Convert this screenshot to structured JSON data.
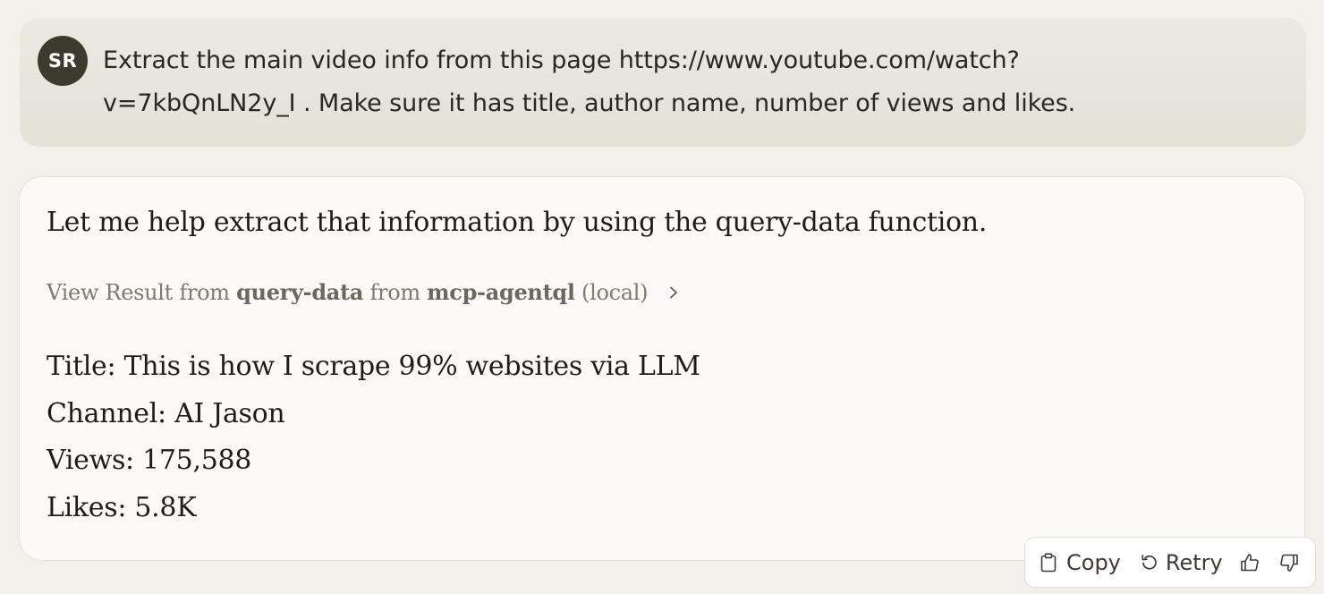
{
  "user_message": {
    "avatar_initials": "SR",
    "text_lines": [
      "Extract the main video info from this page https://www.youtube.com/watch?",
      "v=7kbQnLN2y_I . Make sure it has title, author name, number of views and likes."
    ]
  },
  "assistant_message": {
    "intro": "Let me help extract that information by using the query-data function.",
    "tool_result": {
      "prefix": "View Result from",
      "tool_name": "query-data",
      "middle": "from",
      "server_name": "mcp-agentql",
      "suffix": "(local)",
      "icon": "chevron-right-icon"
    },
    "info_lines": [
      "Title: This is how I scrape 99% websites via LLM",
      "Channel: AI Jason",
      "Views: 175,588",
      "Likes: 5.8K"
    ]
  },
  "actions": {
    "copy_label": "Copy",
    "retry_label": "Retry",
    "copy_icon": "clipboard-icon",
    "retry_icon": "retry-icon",
    "thumbs_up_icon": "thumbs-up-icon",
    "thumbs_down_icon": "thumbs-down-icon"
  },
  "colors": {
    "page_background": "#f2f0ea",
    "user_bubble": "#e7e5dc",
    "avatar": "#3d3a2e",
    "assistant_bubble": "#fbfaf7",
    "muted_text": "#7d7a70"
  }
}
